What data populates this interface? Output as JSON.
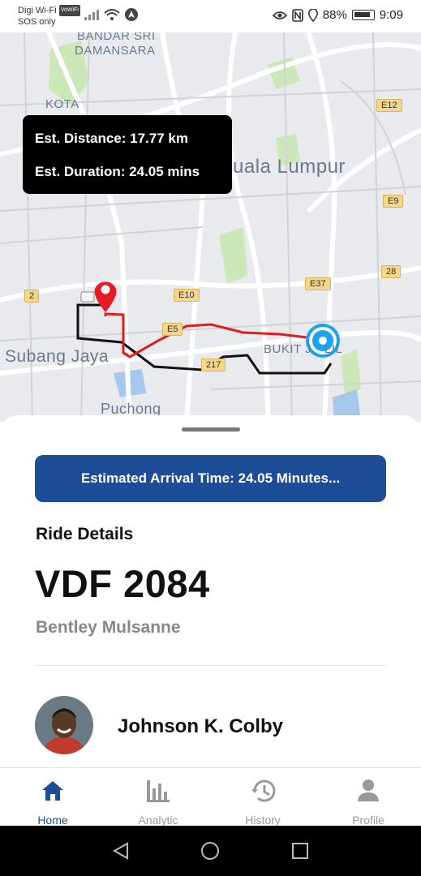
{
  "status_bar": {
    "carrier": "Digi Wi-Fi",
    "volte_badge": "VoWiFi",
    "sos": "SOS only",
    "battery": "88%",
    "time": "9:09"
  },
  "map": {
    "labels": {
      "bandar_sri_1": "BANDAR SRI",
      "bandar_sri_2": "DAMANSARA",
      "kota": "KOTA",
      "kuala_lumpur": "uala Lumpur",
      "subang_jaya": "Subang Jaya",
      "bukit": "BUKIT J",
      "bukit_end": "LIL",
      "puchong": "Puchong"
    },
    "shields": {
      "e12": "E12",
      "e9": "E9",
      "r28": "28",
      "e37": "E37",
      "e10": "E10",
      "r2": "2",
      "e5": "E5",
      "r217": "217"
    },
    "info": {
      "distance": "Est. Distance: 17.77 km",
      "duration": "Est. Duration: 24.05 mins"
    },
    "colors": {
      "route_red": "#e01c1c",
      "route_black": "#111111",
      "pin_red": "#e81b23",
      "location_blue": "#1aa3f0"
    }
  },
  "sheet": {
    "eta_button": "Estimated Arrival Time: 24.05 Minutes...",
    "ride_title": "Ride Details",
    "plate": "VDF 2084",
    "car_model": "Bentley Mulsanne",
    "driver_name": "Johnson K. Colby"
  },
  "nav": {
    "home": "Home",
    "analytic": "Analytic",
    "history": "History",
    "profile": "Profile",
    "active_color": "#1e4d97"
  },
  "icons": [
    "signal-icon",
    "wifi-icon",
    "nav-arrow-icon",
    "eye-icon",
    "nfc-icon",
    "location-icon",
    "battery-icon",
    "home-icon",
    "bar-chart-icon",
    "history-icon",
    "person-icon",
    "back-icon",
    "home-circle-icon",
    "recents-icon"
  ]
}
